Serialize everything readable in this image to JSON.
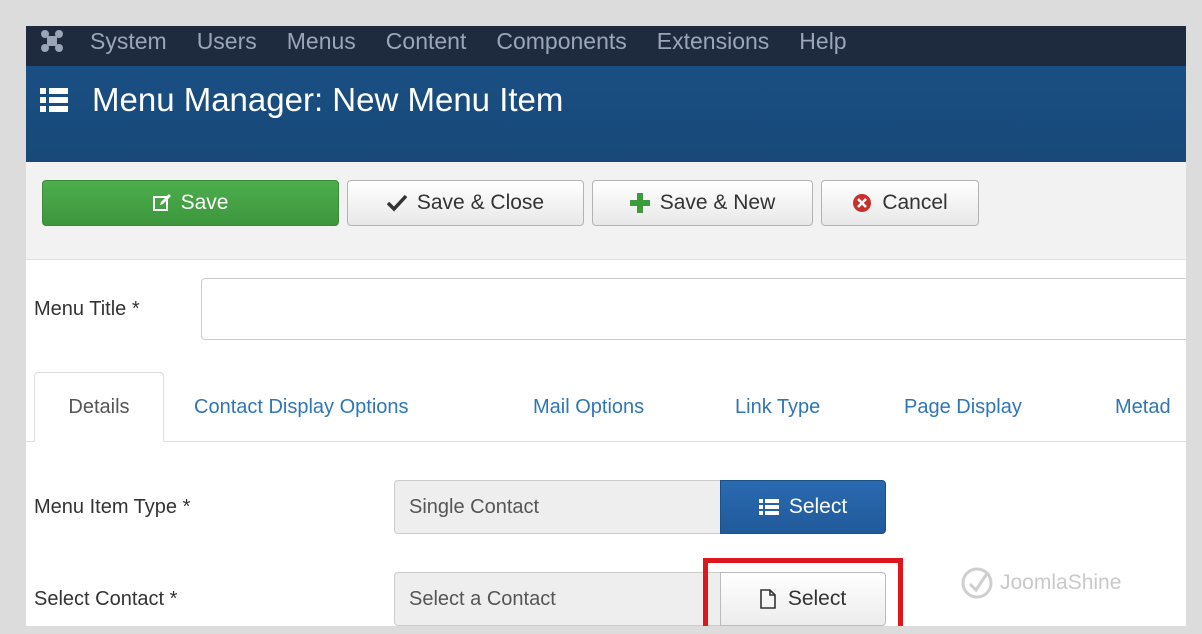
{
  "navbar": {
    "items": [
      "System",
      "Users",
      "Menus",
      "Content",
      "Components",
      "Extensions",
      "Help"
    ]
  },
  "header": {
    "title": "Menu Manager: New Menu Item"
  },
  "toolbar": {
    "save": "Save",
    "save_close": "Save & Close",
    "save_new": "Save & New",
    "cancel": "Cancel"
  },
  "form": {
    "menu_title_label": "Menu Title *",
    "menu_title_value": ""
  },
  "tabs": [
    "Details",
    "Contact Display Options",
    "Mail Options",
    "Link Type",
    "Page Display",
    "Metad"
  ],
  "details": {
    "menu_item_type_label": "Menu Item Type *",
    "menu_item_type_value": "Single Contact",
    "menu_item_type_button": "Select",
    "select_contact_label": "Select Contact *",
    "select_contact_value": "Select a Contact",
    "select_contact_button": "Select"
  },
  "watermark": {
    "text": "JoomlaShine"
  },
  "colors": {
    "navbar_bg": "#1e2a3e",
    "header_bg": "#1a4f84",
    "save_green": "#46a546",
    "primary_blue": "#2a6ab0",
    "link_blue": "#2f76b7",
    "highlight_red": "#e0161d"
  },
  "icons": {
    "navbar": "joomla-logo-icon",
    "header": "list-icon",
    "save": "edit-icon",
    "save_close": "check-icon",
    "save_new": "plus-icon",
    "cancel": "cancel-circle-icon",
    "type_select": "list-icon",
    "contact_select": "file-icon",
    "watermark": "joomlashine-logo-icon"
  }
}
